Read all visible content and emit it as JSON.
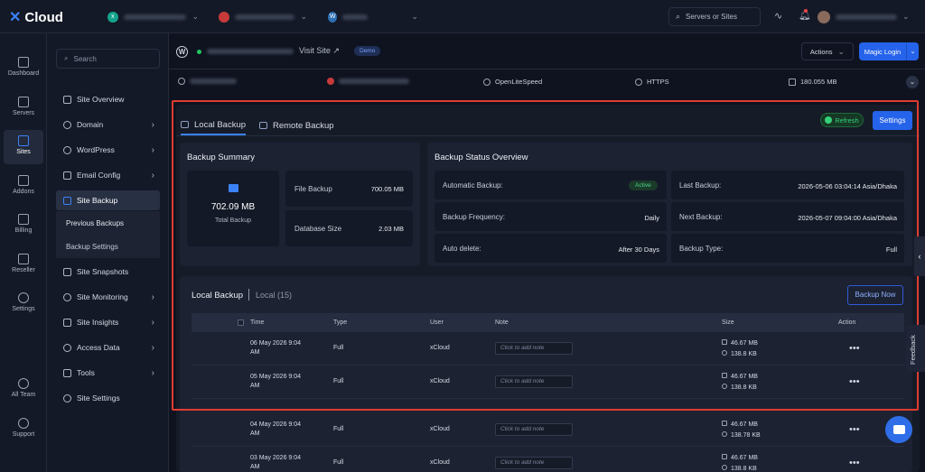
{
  "app": {
    "brand": "Cloud"
  },
  "top": {
    "search_label": "Servers or Sites"
  },
  "rail": {
    "items": [
      {
        "label": "Dashboard"
      },
      {
        "label": "Servers"
      },
      {
        "label": "Sites"
      },
      {
        "label": "Addons"
      },
      {
        "label": "Billing"
      },
      {
        "label": "Reseller"
      },
      {
        "label": "Settings"
      },
      {
        "label": "All Team"
      },
      {
        "label": "Support"
      }
    ]
  },
  "subnav": {
    "search_placeholder": "Search",
    "items": [
      {
        "label": "Site Overview"
      },
      {
        "label": "Domain"
      },
      {
        "label": "WordPress"
      },
      {
        "label": "Email Config"
      },
      {
        "label": "Site Backup"
      },
      {
        "label": "Site Snapshots"
      },
      {
        "label": "Site Monitoring"
      },
      {
        "label": "Site Insights"
      },
      {
        "label": "Access Data"
      },
      {
        "label": "Tools"
      },
      {
        "label": "Site Settings"
      }
    ],
    "sub_items": [
      {
        "label": "Previous Backups"
      },
      {
        "label": "Backup Settings"
      }
    ]
  },
  "site": {
    "visit_label": "Visit Site ↗",
    "demo_badge": "Demo",
    "actions_label": "Actions",
    "magic_login_label": "Magic Login",
    "info": {
      "server": "OpenLiteSpeed",
      "https": "HTTPS",
      "disk": "180.055 MB"
    }
  },
  "tabs": [
    {
      "label": "Local Backup",
      "active": true
    },
    {
      "label": "Remote Backup",
      "active": false
    }
  ],
  "buttons": {
    "refresh": "Refresh",
    "settings": "Settings",
    "backup_now": "Backup Now"
  },
  "summary": {
    "title": "Backup Summary",
    "total_size": "702.09 MB",
    "total_label": "Total Backup",
    "file_backup_label": "File Backup",
    "file_backup_value": "700.05 MB",
    "db_label": "Database Size",
    "db_value": "2.03 MB"
  },
  "status": {
    "title": "Backup Status Overview",
    "auto_label": "Automatic Backup:",
    "auto_value": "Active",
    "freq_label": "Backup Frequency:",
    "freq_value": "Daily",
    "autodel_label": "Auto delete:",
    "autodel_value": "After 30 Days",
    "last_label": "Last Backup:",
    "last_value": "2026-05-06 03:04:14 Asia/Dhaka",
    "next_label": "Next Backup:",
    "next_value": "2026-05-07 09:04:00 Asia/Dhaka",
    "type_label": "Backup Type:",
    "type_value": "Full"
  },
  "list": {
    "title": "Local Backup",
    "subtitle": "Local (15)",
    "columns": [
      "Time",
      "Type",
      "User",
      "Note",
      "Size",
      "Action"
    ],
    "note_placeholder": "Click to add note",
    "rows": [
      {
        "time1": "06 May 2026 9:04",
        "time2": "AM",
        "type": "Full",
        "user": "xCloud",
        "size1": "46.67 MB",
        "size2": "138.8 KB"
      },
      {
        "time1": "05 May 2026 9:04",
        "time2": "AM",
        "type": "Full",
        "user": "xCloud",
        "size1": "46.67 MB",
        "size2": "138.8 KB"
      },
      {
        "time1": "04 May 2026 9:04",
        "time2": "AM",
        "type": "Full",
        "user": "xCloud",
        "size1": "46.67 MB",
        "size2": "138.78 KB"
      },
      {
        "time1": "03 May 2026 9:04",
        "time2": "AM",
        "type": "Full",
        "user": "xCloud",
        "size1": "46.67 MB",
        "size2": "138.8 KB"
      }
    ]
  },
  "feedback_label": "Feedback",
  "colors": {
    "accent": "#2563eb",
    "highlight": "#e03c31",
    "success": "#22c55e"
  }
}
